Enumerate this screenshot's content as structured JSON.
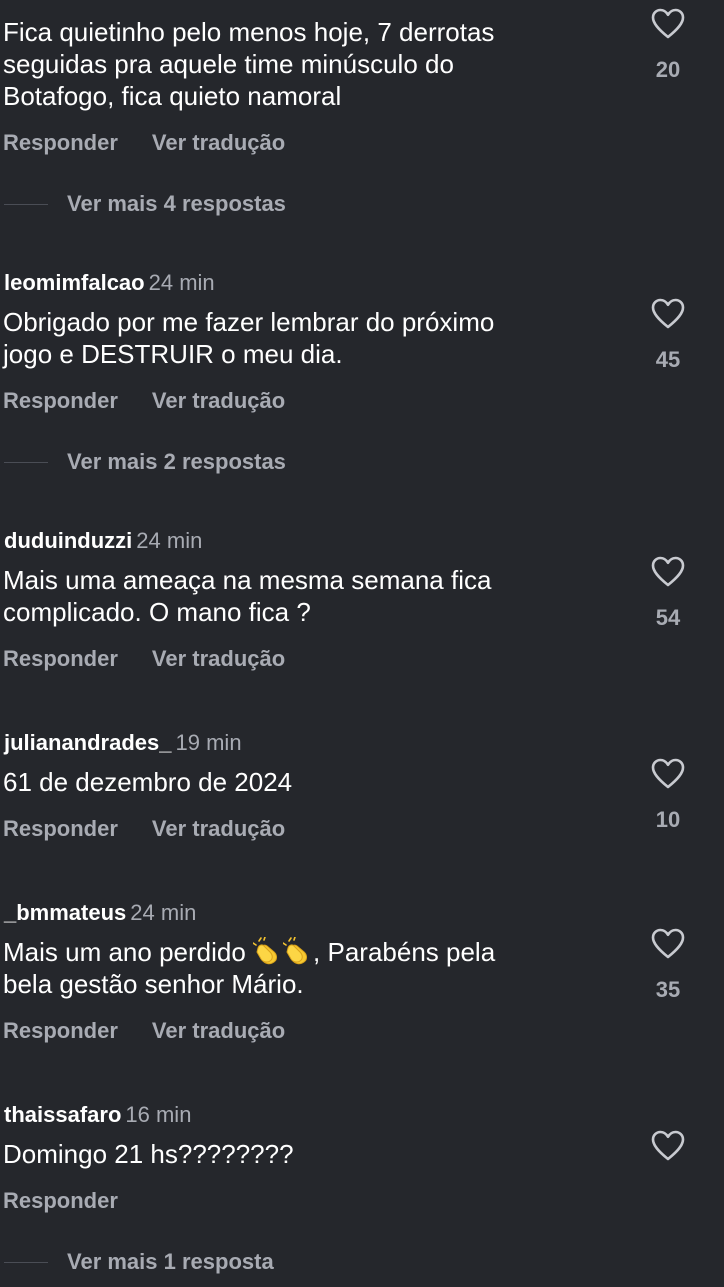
{
  "labels": {
    "reply": "Responder",
    "translate": "Ver tradução"
  },
  "colors": {
    "background": "#25272c",
    "text_primary": "#ffffff",
    "text_secondary": "#a8abb3",
    "like_icon": "#c8cad0"
  },
  "icons": {
    "like": "heart-outline-icon",
    "emoji": "clapping-hands-emoji"
  },
  "comments": [
    {
      "username": "",
      "time": "",
      "text": "Fica quietinho pelo menos hoje, 7 derrotas\nseguidas pra aquele time minúsculo do\nBotafogo, fica quieto namoral",
      "likes": "20",
      "replies": "Ver mais 4 respostas"
    },
    {
      "username": "leomimfalcao",
      "time": "24 min",
      "text": "Obrigado por me fazer lembrar do próximo\njogo e DESTRUIR o meu dia.",
      "likes": "45",
      "replies": "Ver mais 2 respostas"
    },
    {
      "username": "duduinduzzi",
      "time": "24 min",
      "text": "Mais uma ameaça na mesma semana fica\ncomplicado. O mano fica ?",
      "likes": "54"
    },
    {
      "username": "julianandrades_",
      "time": "19 min",
      "text": "61 de dezembro de 2024",
      "likes": "10"
    },
    {
      "username": "_bmmateus",
      "time": "24 min",
      "text_before_emoji": "Mais um ano perdido ",
      "text_after_emoji": ", Parabéns pela\nbela gestão senhor Mário.",
      "likes": "35"
    },
    {
      "username": "thaissafaro",
      "time": "16 min",
      "text": "Domingo 21 hs????????",
      "likes": "",
      "replies": "Ver mais 1 resposta"
    }
  ]
}
